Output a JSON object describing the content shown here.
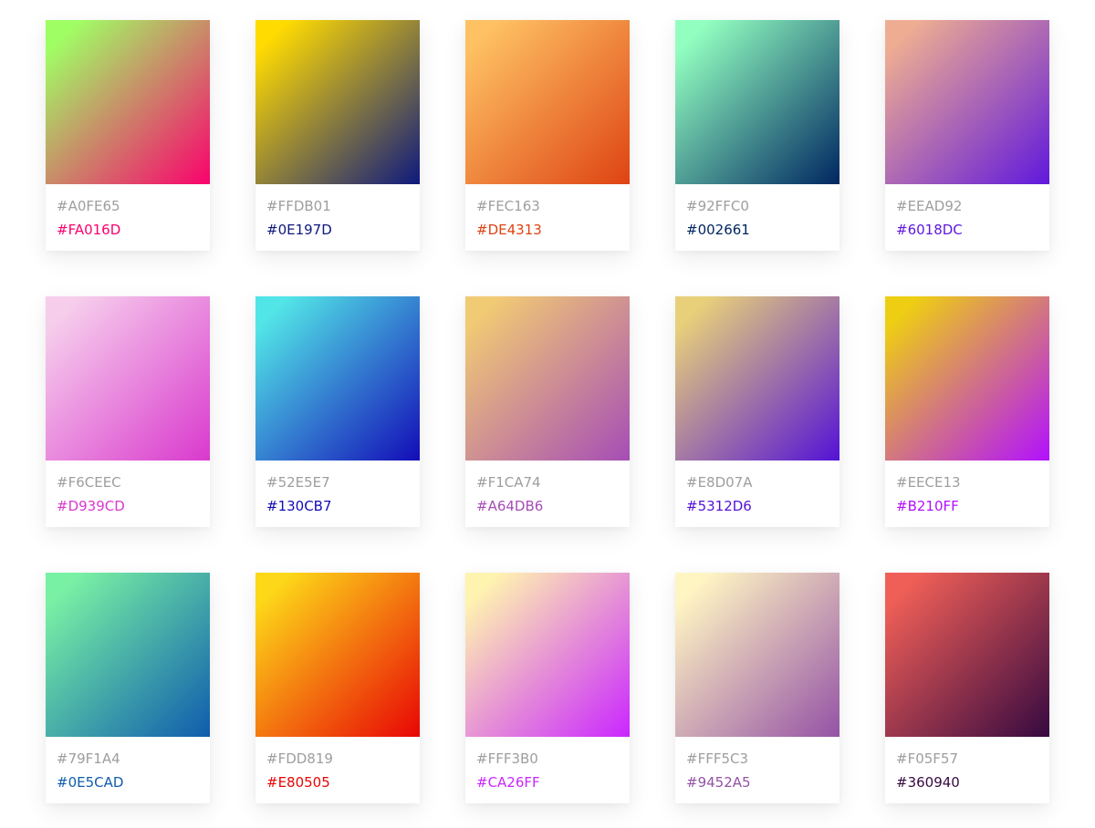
{
  "gradients": [
    {
      "start": "#A0FE65",
      "end": "#FA016D"
    },
    {
      "start": "#FFDB01",
      "end": "#0E197D"
    },
    {
      "start": "#FEC163",
      "end": "#DE4313"
    },
    {
      "start": "#92FFC0",
      "end": "#002661"
    },
    {
      "start": "#EEAD92",
      "end": "#6018DC"
    },
    {
      "start": "#F6CEEC",
      "end": "#D939CD"
    },
    {
      "start": "#52E5E7",
      "end": "#130CB7"
    },
    {
      "start": "#F1CA74",
      "end": "#A64DB6"
    },
    {
      "start": "#E8D07A",
      "end": "#5312D6"
    },
    {
      "start": "#EECE13",
      "end": "#B210FF"
    },
    {
      "start": "#79F1A4",
      "end": "#0E5CAD"
    },
    {
      "start": "#FDD819",
      "end": "#E80505"
    },
    {
      "start": "#FFF3B0",
      "end": "#CA26FF"
    },
    {
      "start": "#FFF5C3",
      "end": "#9452A5"
    },
    {
      "start": "#F05F57",
      "end": "#360940"
    }
  ]
}
